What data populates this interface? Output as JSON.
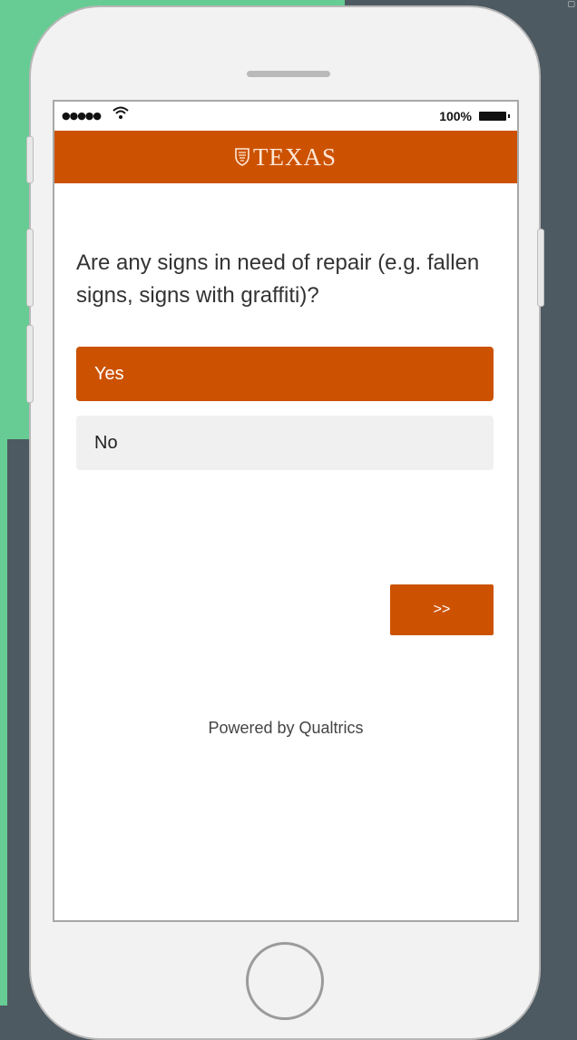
{
  "status_bar": {
    "signal": "●●●●●",
    "wifi_icon": "wifi-icon",
    "battery_text": "100%"
  },
  "header": {
    "logo_icon": "shield-icon",
    "logo_text": "TEXAS"
  },
  "survey": {
    "question": "Are any signs in need of repair (e.g. fallen signs, signs with graffiti)?",
    "choices": [
      {
        "label": "Yes",
        "selected": true
      },
      {
        "label": "No",
        "selected": false
      }
    ],
    "next_label": ">>"
  },
  "footer": {
    "powered_by": "Powered by Qualtrics"
  },
  "colors": {
    "accent": "#cc5202",
    "background": "#4e5a62",
    "green": "#67cc93"
  }
}
